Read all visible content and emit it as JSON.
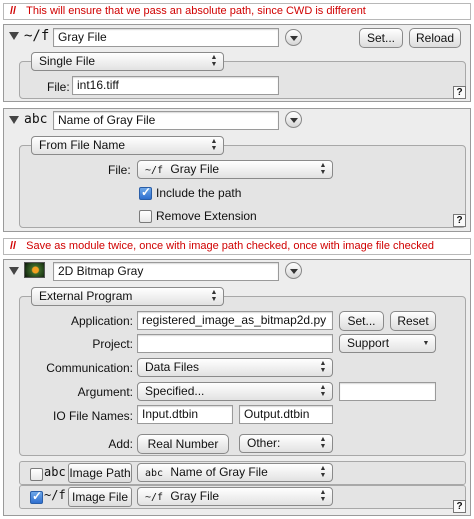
{
  "comment1": {
    "slashes": "//",
    "text": "This will ensure that we pass an absolute path, since CWD is different"
  },
  "module1": {
    "type_icon": "~/f",
    "name": "Gray File",
    "set_label": "Set...",
    "reload_label": "Reload",
    "mode": "Single File",
    "file_label": "File:",
    "file_value": "int16.tiff",
    "help": "?"
  },
  "module2": {
    "type_icon": "abc",
    "name": "Name of Gray File",
    "mode": "From File Name",
    "file_label": "File:",
    "file_type_icon": "~/f",
    "file_value": "Gray File",
    "include_path_label": "Include the path",
    "include_path_checked": true,
    "remove_ext_label": "Remove Extension",
    "remove_ext_checked": false,
    "help": "?"
  },
  "comment2": {
    "slashes": "//",
    "text": "Save as module twice, once with image path checked, once with image file checked"
  },
  "module3": {
    "name": "2D Bitmap Gray",
    "mode": "External Program",
    "application_label": "Application:",
    "application_value": "registered_image_as_bitmap2d.py",
    "set_label": "Set...",
    "reset_label": "Reset",
    "project_label": "Project:",
    "project_value": "",
    "project_select": "Support",
    "communication_label": "Communication:",
    "communication_value": "Data Files",
    "argument_label": "Argument:",
    "argument_value": "Specified...",
    "argument_extra": "",
    "io_label": "IO File Names:",
    "io_input": "Input.dtbin",
    "io_output": "Output.dtbin",
    "add_label": "Add:",
    "add_button": "Real Number",
    "add_other": "Other:",
    "inputs": [
      {
        "checked": false,
        "type_icon": "abc",
        "label": "Image Path",
        "source_icon": "abc",
        "source": "Name of Gray File"
      },
      {
        "checked": true,
        "type_icon": "~/f",
        "label": "Image File",
        "source_icon": "~/f",
        "source": "Gray File"
      }
    ],
    "help": "?"
  }
}
